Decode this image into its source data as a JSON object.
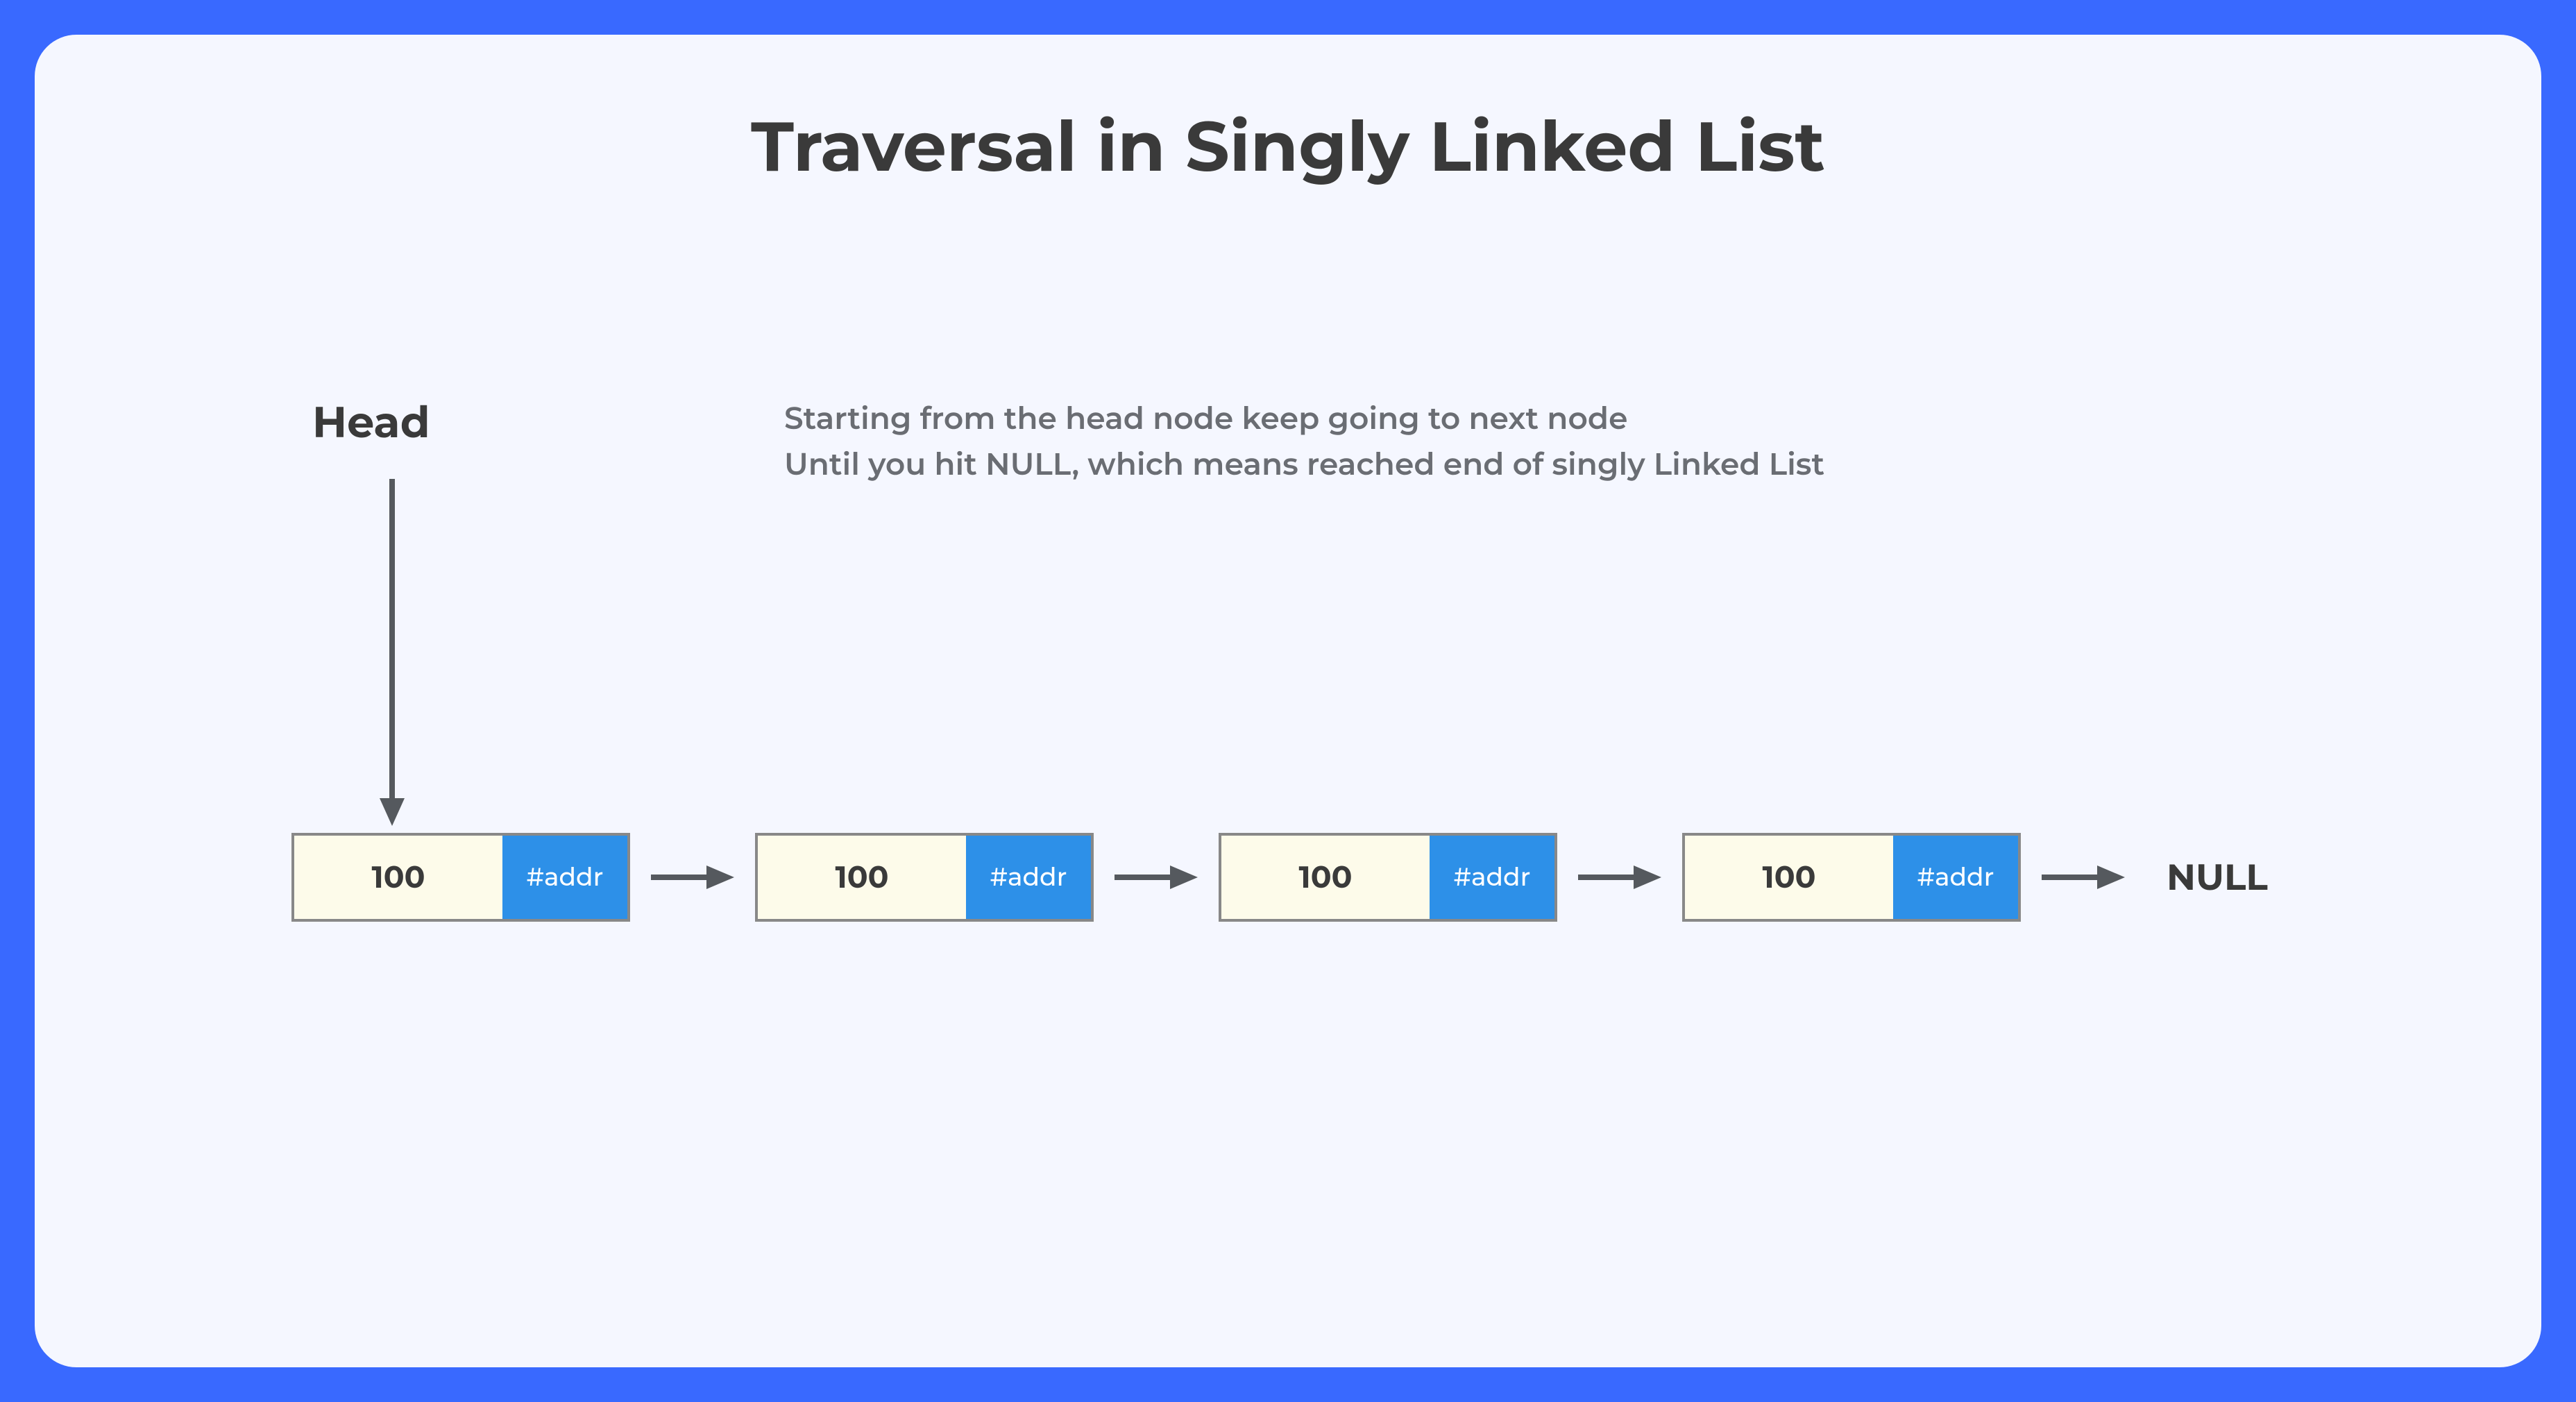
{
  "title": "Traversal in Singly Linked List",
  "head_label": "Head",
  "description_line1": "Starting from the head node keep going to next node",
  "description_line2": "Until you hit NULL, which means reached end of singly Linked List",
  "null_label": "NULL",
  "nodes": [
    {
      "value": "100",
      "addr": "#addr"
    },
    {
      "value": "100",
      "addr": "#addr"
    },
    {
      "value": "100",
      "addr": "#addr"
    },
    {
      "value": "100",
      "addr": "#addr"
    }
  ],
  "colors": {
    "frame": "#3969ff",
    "canvas": "#f5f7ff",
    "node_value_bg": "#fdfbea",
    "node_addr_bg": "#2d90e8",
    "text_dark": "#3a3a3a",
    "text_grey": "#6a6d73",
    "arrow": "#55595e"
  }
}
